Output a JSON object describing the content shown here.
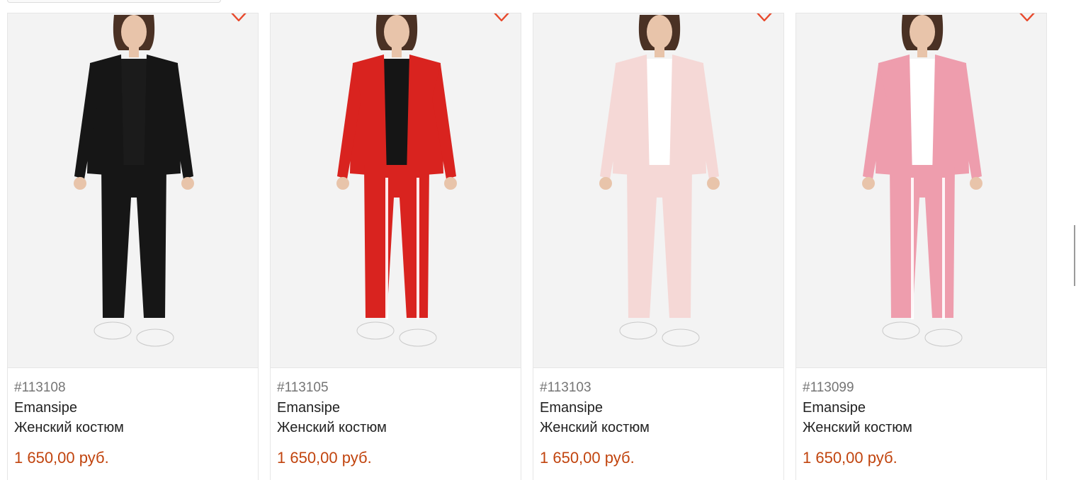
{
  "products": [
    {
      "sku": "#113108",
      "brand": "Emansipe",
      "name": "Женский костюм",
      "price": "1 650,00 руб.",
      "suit_color": "#161616",
      "shirt_color": "#1b1b1b",
      "stripe": false
    },
    {
      "sku": "#113105",
      "brand": "Emansipe",
      "name": "Женский костюм",
      "price": "1 650,00 руб.",
      "suit_color": "#d9231f",
      "shirt_color": "#151515",
      "stripe": true
    },
    {
      "sku": "#113103",
      "brand": "Emansipe",
      "name": "Женский костюм",
      "price": "1 650,00 руб.",
      "suit_color": "#f5d8d6",
      "shirt_color": "#ffffff",
      "stripe": false
    },
    {
      "sku": "#113099",
      "brand": "Emansipe",
      "name": "Женский костюм",
      "price": "1 650,00 руб.",
      "suit_color": "#ee9dad",
      "shirt_color": "#ffffff",
      "stripe": true
    }
  ],
  "icons": {
    "favorite": "heart-outline-icon"
  },
  "colors": {
    "price": "#c1440e",
    "favorite": "#e8492c"
  }
}
